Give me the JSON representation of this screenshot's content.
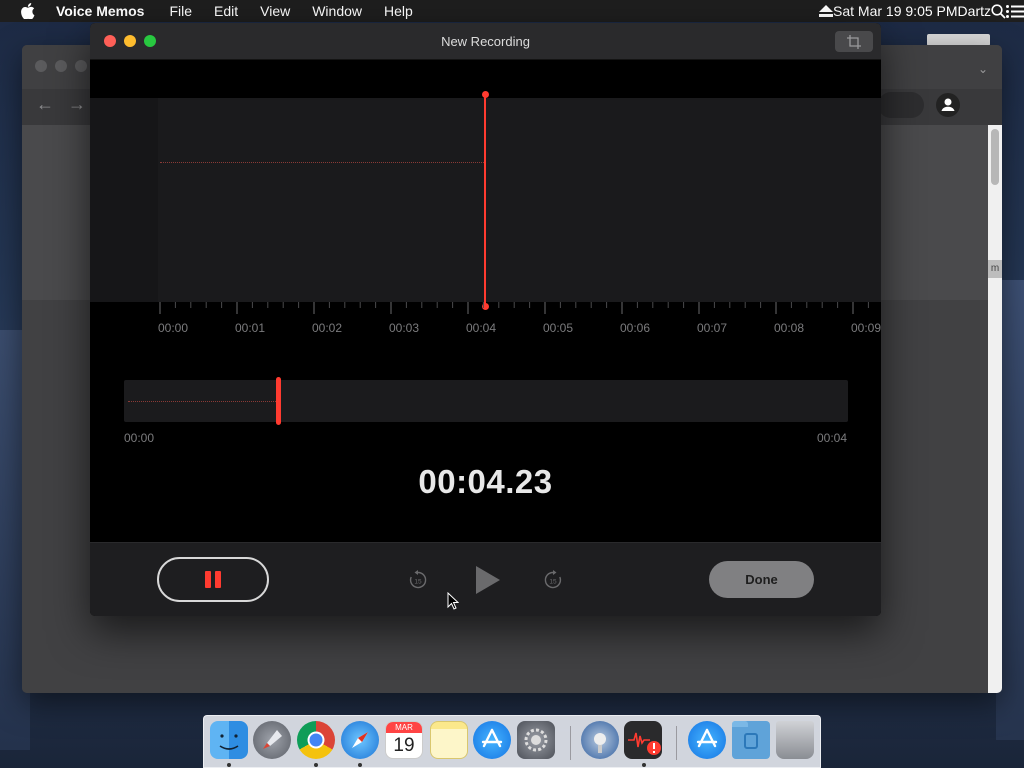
{
  "menubar": {
    "app_name": "Voice Memos",
    "menus": [
      "File",
      "Edit",
      "View",
      "Window",
      "Help"
    ],
    "clock": "Sat Mar 19  9:05 PM",
    "user": "Dartz"
  },
  "window": {
    "title": "New Recording"
  },
  "timeline": {
    "ticks": [
      "00:00",
      "00:01",
      "00:02",
      "00:03",
      "00:04",
      "00:05",
      "00:06",
      "00:07",
      "00:08",
      "00:09"
    ]
  },
  "overview": {
    "start": "00:00",
    "end": "00:04",
    "playhead_fraction": 0.21
  },
  "recording": {
    "elapsed": "00:04.23"
  },
  "controls": {
    "done_label": "Done",
    "skip_back_label": "15",
    "skip_fwd_label": "15"
  },
  "dock": {
    "calendar_month": "MAR",
    "calendar_day": "19"
  },
  "colors": {
    "accent": "#ff3b30"
  }
}
